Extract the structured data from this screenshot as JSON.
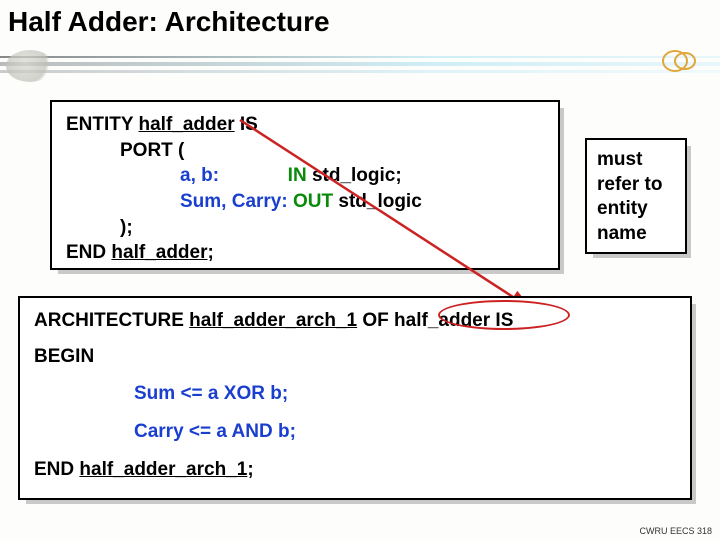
{
  "title": "Half Adder:  Architecture",
  "entity": {
    "line1_pre": "ENTITY ",
    "name": "half_adder",
    "line1_post": " IS",
    "port_open": "PORT (",
    "port1_sigs": "a, b:",
    "port1_dir": "             IN",
    "port1_type": " std_logic;",
    "port2_sigs": "Sum, Carry:",
    "port2_dir": " OUT",
    "port2_type": " std_logic",
    "port_close": ");",
    "end_pre": "END ",
    "end_post": ";"
  },
  "annotation": {
    "text": "must refer to entity name"
  },
  "arch": {
    "line1_pre": "ARCHITECTURE ",
    "arch_name": "half_adder_arch_1",
    "line1_mid": " OF ",
    "entity_ref": "half_adder",
    "line1_post": " IS",
    "begin": "BEGIN",
    "stmt1": "Sum <= a XOR b;",
    "stmt2": "Carry <= a AND b;",
    "end_pre": "END ",
    "end_name": "half_adder_arch_1",
    "end_post": ";"
  },
  "footer": "CWRU EECS 318"
}
